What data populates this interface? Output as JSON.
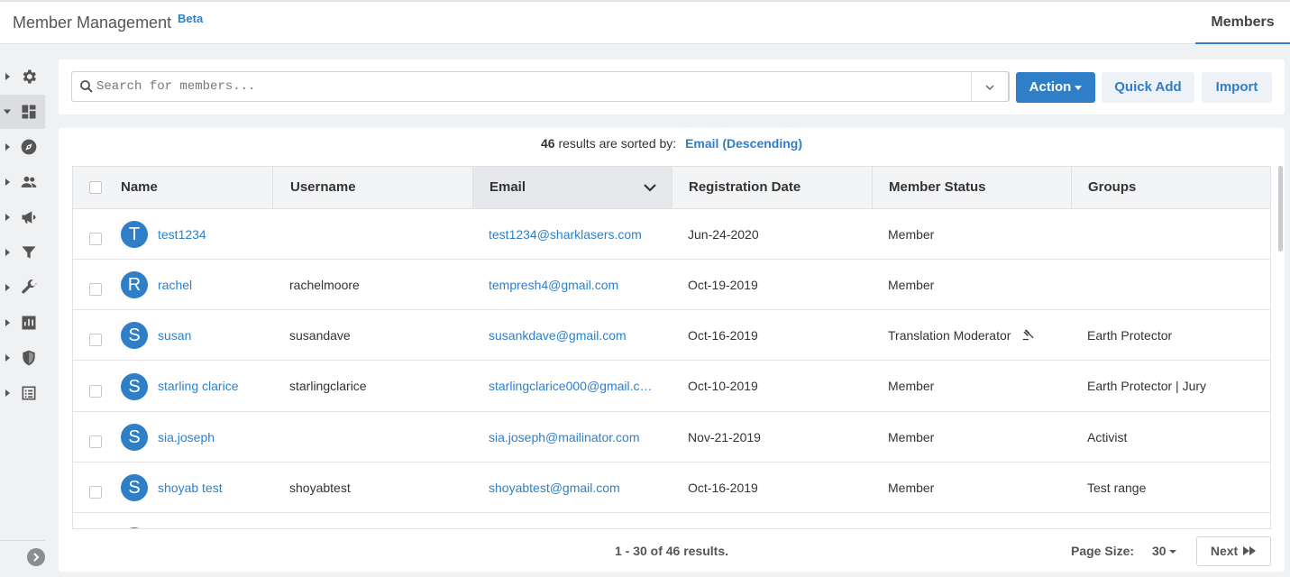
{
  "header": {
    "title": "Member Management",
    "badge": "Beta",
    "tab": "Members"
  },
  "sidebar": {
    "items": [
      {
        "icon": "gear-icon"
      },
      {
        "icon": "dashboard-icon",
        "active": true
      },
      {
        "icon": "compass-icon"
      },
      {
        "icon": "people-icon"
      },
      {
        "icon": "megaphone-icon"
      },
      {
        "icon": "filter-icon"
      },
      {
        "icon": "wrench-icon"
      },
      {
        "icon": "bar-chart-icon"
      },
      {
        "icon": "shield-icon"
      },
      {
        "icon": "list-icon"
      }
    ]
  },
  "search": {
    "placeholder": "Search for members..."
  },
  "toolbar": {
    "action_label": "Action",
    "quick_add_label": "Quick Add",
    "import_label": "Import"
  },
  "sort": {
    "count": "46",
    "text": "results are sorted by:",
    "field": "Email (Descending)"
  },
  "table": {
    "columns": [
      "Name",
      "Username",
      "Email",
      "Registration Date",
      "Member Status",
      "Groups"
    ],
    "rows": [
      {
        "initial": "T",
        "name": "test1234",
        "username": "",
        "email": "test1234@sharklasers.com",
        "date": "Jun-24-2020",
        "status": "Member",
        "groups": ""
      },
      {
        "initial": "R",
        "name": "rachel",
        "username": "rachelmoore",
        "email": "tempresh4@gmail.com",
        "date": "Oct-19-2019",
        "status": "Member",
        "groups": ""
      },
      {
        "initial": "S",
        "name": "susan",
        "username": "susandave",
        "email": "susankdave@gmail.com",
        "date": "Oct-16-2019",
        "status": "Translation Moderator",
        "groups": "Earth Protector"
      },
      {
        "initial": "S",
        "name": "starling clarice",
        "username": "starlingclarice",
        "email": "starlingclarice000@gmail.c…",
        "date": "Oct-10-2019",
        "status": "Member",
        "groups": "Earth Protector | Jury"
      },
      {
        "initial": "S",
        "name": "sia.joseph",
        "username": "",
        "email": "sia.joseph@mailinator.com",
        "date": "Nov-21-2019",
        "status": "Member",
        "groups": "Activist"
      },
      {
        "initial": "S",
        "name": "shoyab test",
        "username": "shoyabtest",
        "email": "shoyabtest@gmail.com",
        "date": "Oct-16-2019",
        "status": "Member",
        "groups": "Test range"
      }
    ]
  },
  "footer": {
    "results": "1 - 30 of 46 results.",
    "page_size_label": "Page Size:",
    "page_size": "30",
    "next_label": "Next"
  },
  "colors": {
    "accent": "#2f7fc8"
  }
}
